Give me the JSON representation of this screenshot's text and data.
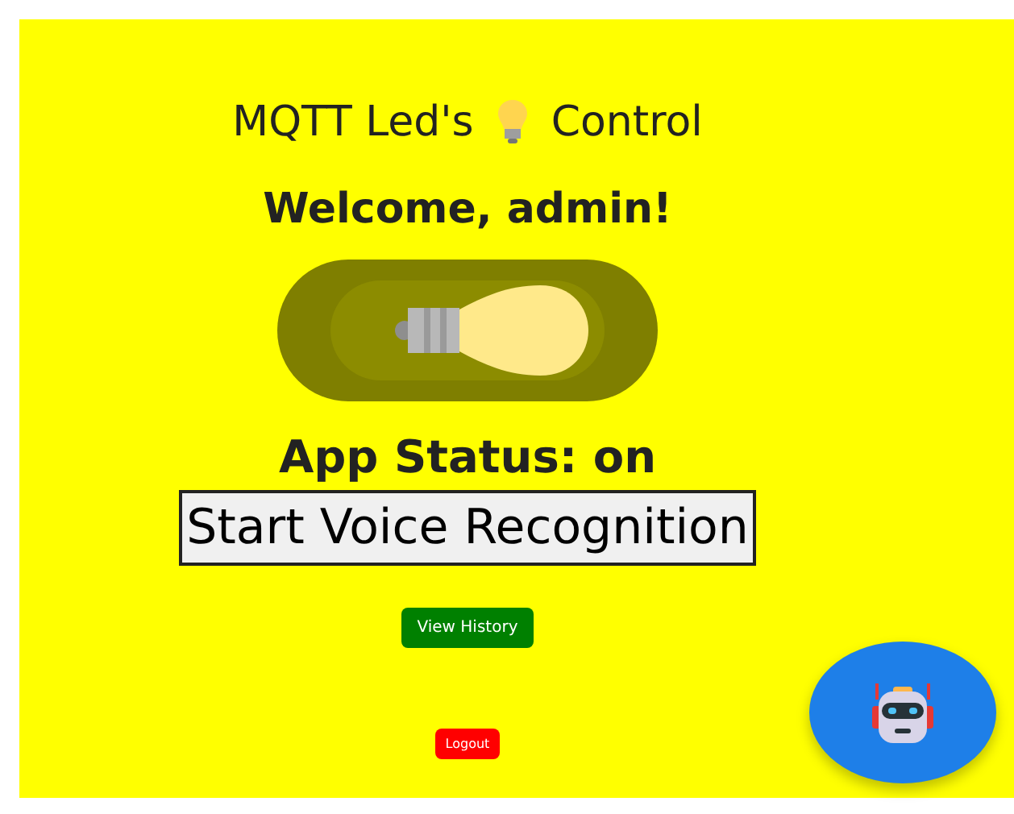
{
  "title": {
    "before": "MQTT Led's",
    "after": "Control"
  },
  "welcome": "Welcome, admin!",
  "lamp_switch": {
    "on": true
  },
  "status": "App Status: on",
  "voice_button": "Start Voice Recognition",
  "history_button": "View History",
  "logout_button": "Logout"
}
